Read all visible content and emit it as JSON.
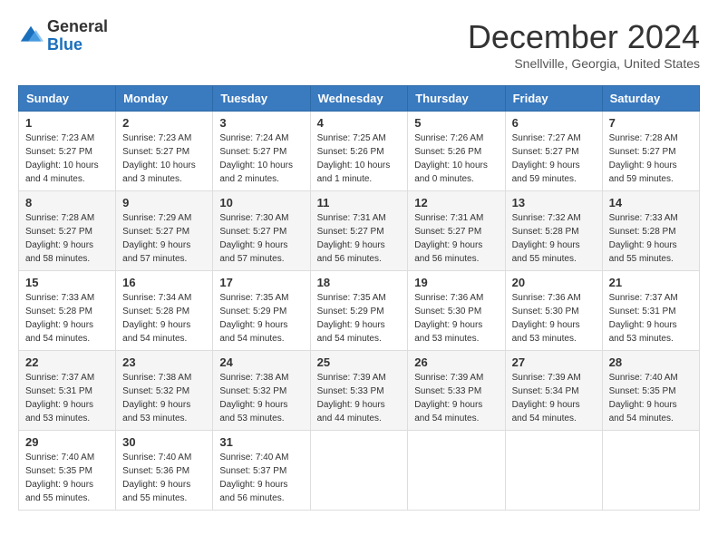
{
  "header": {
    "logo_line1": "General",
    "logo_line2": "Blue",
    "month": "December 2024",
    "location": "Snellville, Georgia, United States"
  },
  "days_of_week": [
    "Sunday",
    "Monday",
    "Tuesday",
    "Wednesday",
    "Thursday",
    "Friday",
    "Saturday"
  ],
  "weeks": [
    [
      {
        "day": "1",
        "sunrise": "7:23 AM",
        "sunset": "5:27 PM",
        "daylight": "10 hours and 4 minutes."
      },
      {
        "day": "2",
        "sunrise": "7:23 AM",
        "sunset": "5:27 PM",
        "daylight": "10 hours and 3 minutes."
      },
      {
        "day": "3",
        "sunrise": "7:24 AM",
        "sunset": "5:27 PM",
        "daylight": "10 hours and 2 minutes."
      },
      {
        "day": "4",
        "sunrise": "7:25 AM",
        "sunset": "5:26 PM",
        "daylight": "10 hours and 1 minute."
      },
      {
        "day": "5",
        "sunrise": "7:26 AM",
        "sunset": "5:26 PM",
        "daylight": "10 hours and 0 minutes."
      },
      {
        "day": "6",
        "sunrise": "7:27 AM",
        "sunset": "5:27 PM",
        "daylight": "9 hours and 59 minutes."
      },
      {
        "day": "7",
        "sunrise": "7:28 AM",
        "sunset": "5:27 PM",
        "daylight": "9 hours and 59 minutes."
      }
    ],
    [
      {
        "day": "8",
        "sunrise": "7:28 AM",
        "sunset": "5:27 PM",
        "daylight": "9 hours and 58 minutes."
      },
      {
        "day": "9",
        "sunrise": "7:29 AM",
        "sunset": "5:27 PM",
        "daylight": "9 hours and 57 minutes."
      },
      {
        "day": "10",
        "sunrise": "7:30 AM",
        "sunset": "5:27 PM",
        "daylight": "9 hours and 57 minutes."
      },
      {
        "day": "11",
        "sunrise": "7:31 AM",
        "sunset": "5:27 PM",
        "daylight": "9 hours and 56 minutes."
      },
      {
        "day": "12",
        "sunrise": "7:31 AM",
        "sunset": "5:27 PM",
        "daylight": "9 hours and 56 minutes."
      },
      {
        "day": "13",
        "sunrise": "7:32 AM",
        "sunset": "5:28 PM",
        "daylight": "9 hours and 55 minutes."
      },
      {
        "day": "14",
        "sunrise": "7:33 AM",
        "sunset": "5:28 PM",
        "daylight": "9 hours and 55 minutes."
      }
    ],
    [
      {
        "day": "15",
        "sunrise": "7:33 AM",
        "sunset": "5:28 PM",
        "daylight": "9 hours and 54 minutes."
      },
      {
        "day": "16",
        "sunrise": "7:34 AM",
        "sunset": "5:28 PM",
        "daylight": "9 hours and 54 minutes."
      },
      {
        "day": "17",
        "sunrise": "7:35 AM",
        "sunset": "5:29 PM",
        "daylight": "9 hours and 54 minutes."
      },
      {
        "day": "18",
        "sunrise": "7:35 AM",
        "sunset": "5:29 PM",
        "daylight": "9 hours and 54 minutes."
      },
      {
        "day": "19",
        "sunrise": "7:36 AM",
        "sunset": "5:30 PM",
        "daylight": "9 hours and 53 minutes."
      },
      {
        "day": "20",
        "sunrise": "7:36 AM",
        "sunset": "5:30 PM",
        "daylight": "9 hours and 53 minutes."
      },
      {
        "day": "21",
        "sunrise": "7:37 AM",
        "sunset": "5:31 PM",
        "daylight": "9 hours and 53 minutes."
      }
    ],
    [
      {
        "day": "22",
        "sunrise": "7:37 AM",
        "sunset": "5:31 PM",
        "daylight": "9 hours and 53 minutes."
      },
      {
        "day": "23",
        "sunrise": "7:38 AM",
        "sunset": "5:32 PM",
        "daylight": "9 hours and 53 minutes."
      },
      {
        "day": "24",
        "sunrise": "7:38 AM",
        "sunset": "5:32 PM",
        "daylight": "9 hours and 53 minutes."
      },
      {
        "day": "25",
        "sunrise": "7:39 AM",
        "sunset": "5:33 PM",
        "daylight": "9 hours and 44 minutes."
      },
      {
        "day": "26",
        "sunrise": "7:39 AM",
        "sunset": "5:33 PM",
        "daylight": "9 hours and 54 minutes."
      },
      {
        "day": "27",
        "sunrise": "7:39 AM",
        "sunset": "5:34 PM",
        "daylight": "9 hours and 54 minutes."
      },
      {
        "day": "28",
        "sunrise": "7:40 AM",
        "sunset": "5:35 PM",
        "daylight": "9 hours and 54 minutes."
      }
    ],
    [
      {
        "day": "29",
        "sunrise": "7:40 AM",
        "sunset": "5:35 PM",
        "daylight": "9 hours and 55 minutes."
      },
      {
        "day": "30",
        "sunrise": "7:40 AM",
        "sunset": "5:36 PM",
        "daylight": "9 hours and 55 minutes."
      },
      {
        "day": "31",
        "sunrise": "7:40 AM",
        "sunset": "5:37 PM",
        "daylight": "9 hours and 56 minutes."
      },
      null,
      null,
      null,
      null
    ]
  ],
  "labels": {
    "sunrise_prefix": "Sunrise: ",
    "sunset_prefix": "Sunset: ",
    "daylight_prefix": "Daylight: "
  }
}
